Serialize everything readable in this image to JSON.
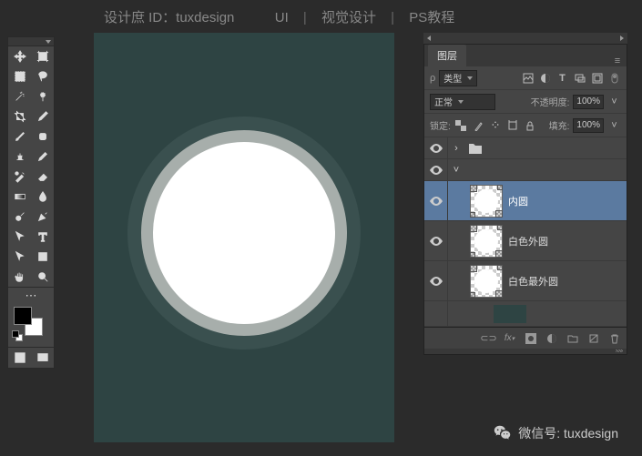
{
  "header": {
    "brand": "设计庶 ID：tuxdesign",
    "tags": [
      "UI",
      "视觉设计",
      "PS教程"
    ]
  },
  "toolbar": {
    "tools": [
      "move-tool",
      "artboard-tool",
      "marquee-tool",
      "lasso-tool",
      "magic-wand-tool",
      "quick-select-tool",
      "crop-tool",
      "eyedropper-tool",
      "brush-tool",
      "healing-brush-tool",
      "clone-stamp-tool",
      "pencil-tool",
      "history-brush-tool",
      "eraser-tool",
      "gradient-tool",
      "blur-tool",
      "dodge-tool",
      "pen-tool",
      "path-select-tool",
      "type-tool",
      "direct-select-tool",
      "shape-tool",
      "hand-tool",
      "zoom-tool"
    ],
    "fg_color": "#000000",
    "bg_color": "#ffffff"
  },
  "canvas": {
    "bg_color": "#2e4443"
  },
  "layers_panel": {
    "title": "图层",
    "filter": {
      "label": "类型",
      "search_placeholder": "ρ"
    },
    "blend_mode": "正常",
    "opacity_label": "不透明度:",
    "opacity_value": "100%",
    "lock_label": "锁定:",
    "fill_label": "填充:",
    "fill_value": "100%",
    "layers": [
      {
        "name": "内圆",
        "selected": true
      },
      {
        "name": "白色外圆",
        "selected": false
      },
      {
        "name": "白色最外圆",
        "selected": false
      }
    ],
    "footer_icons": [
      "link-icon",
      "fx-icon",
      "mask-icon",
      "adjustment-icon",
      "group-icon",
      "new-layer-icon",
      "trash-icon"
    ]
  },
  "wechat": {
    "label": "微信号: tuxdesign"
  }
}
